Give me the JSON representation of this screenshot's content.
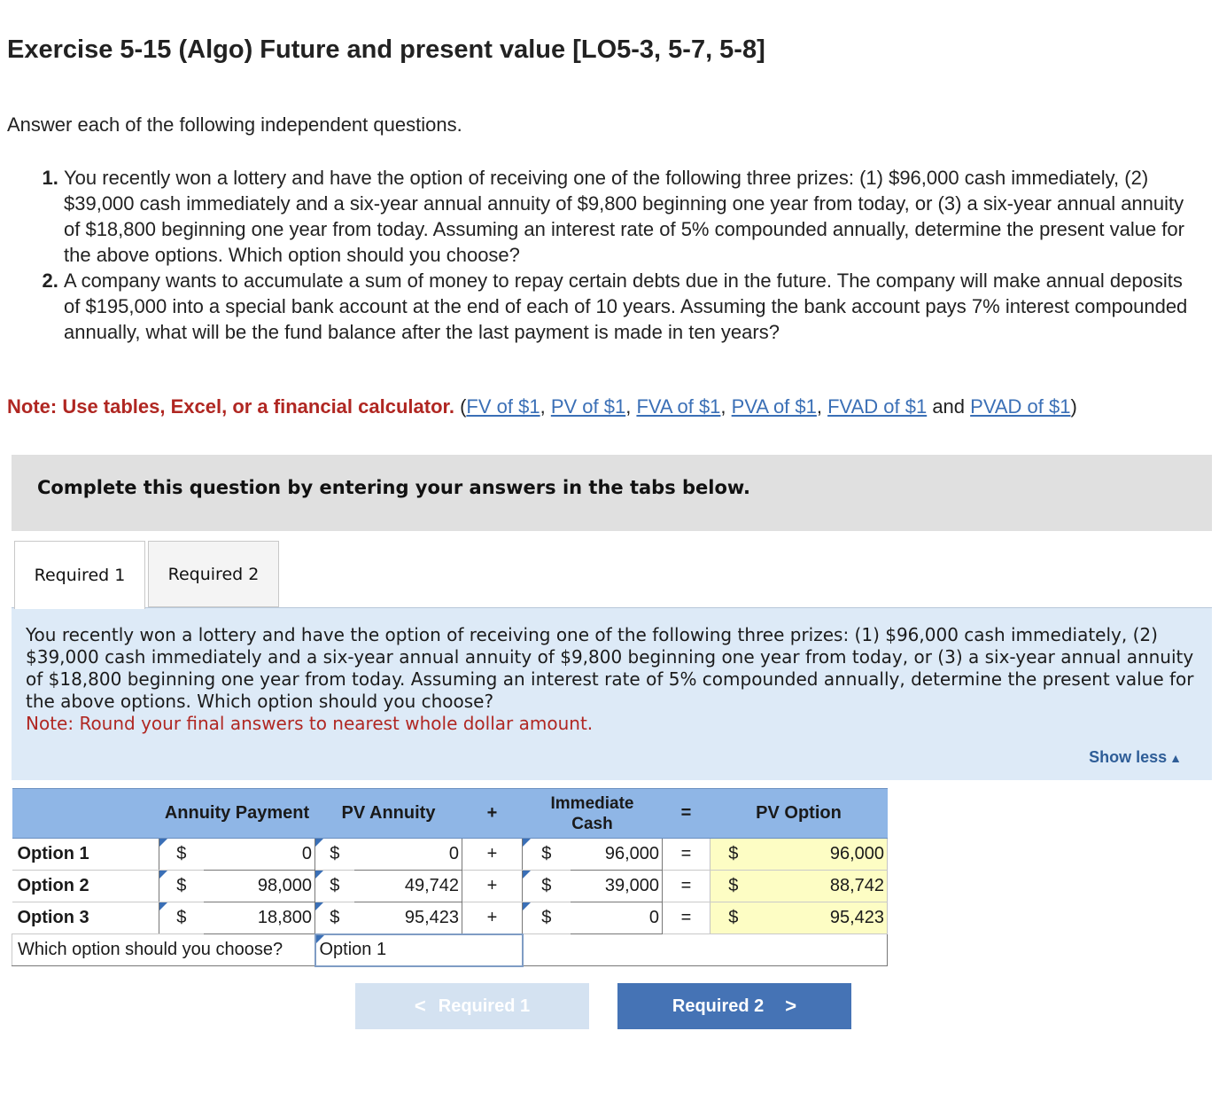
{
  "title": "Exercise 5-15 (Algo) Future and present value [LO5-3, 5-7, 5-8]",
  "intro": "Answer each of the following independent questions.",
  "questions": [
    "You recently won a lottery and have the option of receiving one of the following three prizes: (1) $96,000 cash immediately, (2) $39,000 cash immediately and a six-year annual annuity of $9,800 beginning one year from today, or (3) a six-year annual annuity of $18,800 beginning one year from today. Assuming an interest rate of 5% compounded annually, determine the present value for the above options. Which option should you choose?",
    "A company wants to accumulate a sum of money to repay certain debts due in the future. The company will make annual deposits of $195,000 into a special bank account at the end of each of 10 years. Assuming the bank account pays 7% interest compounded annually, what will be the fund balance after the last payment is made in ten years?"
  ],
  "note": {
    "label": "Note: Use tables, Excel, or a financial calculator.",
    "open": " (",
    "links": [
      "FV of $1",
      "PV of $1",
      "FVA of $1",
      "PVA of $1",
      "FVAD of $1",
      "PVAD of $1"
    ],
    "sep": ", ",
    "and": " and ",
    "close": ")"
  },
  "banner": "Complete this question by entering your answers in the tabs below.",
  "tabs": [
    "Required 1",
    "Required 2"
  ],
  "panel": {
    "text": "You recently won a lottery and have the option of receiving one of the following three prizes: (1) $96,000 cash immediately, (2) $39,000 cash immediately and a six-year annual annuity of $9,800 beginning one year from today, or (3) a six-year annual annuity of $18,800 beginning one year from today. Assuming an interest rate of 5% compounded annually, determine the present value for the above options. Which option should you choose?",
    "note": "Note: Round your final answers to nearest whole dollar amount.",
    "show_less": "Show less"
  },
  "table": {
    "headers": {
      "annuity_payment": "Annuity Payment",
      "pv_annuity": "PV Annuity",
      "plus": "+",
      "immediate_line1": "Immediate",
      "immediate_line2": "Cash",
      "equals": "=",
      "pv_option": "PV Option"
    },
    "currency": "$",
    "plus": "+",
    "equals": "=",
    "rows": [
      {
        "label": "Option 1",
        "annuity_payment": "0",
        "pv_annuity": "0",
        "immediate_cash": "96,000",
        "pv_option": "96,000"
      },
      {
        "label": "Option 2",
        "annuity_payment": "98,000",
        "pv_annuity": "49,742",
        "immediate_cash": "39,000",
        "pv_option": "88,742"
      },
      {
        "label": "Option 3",
        "annuity_payment": "18,800",
        "pv_annuity": "95,423",
        "immediate_cash": "0",
        "pv_option": "95,423"
      }
    ],
    "choice_question": "Which option should you choose?",
    "choice_answer": "Option 1"
  },
  "nav": {
    "prev_label": "Required 1",
    "next_label": "Required 2",
    "prev_icon": "chevron-left-icon",
    "next_icon": "chevron-right-icon"
  },
  "colors": {
    "header_blue": "#8fb6e6",
    "panel_blue": "#ddeaf7",
    "note_red": "#b02722",
    "link_blue": "#3a6fb6",
    "button_blue": "#4573b5",
    "button_disabled": "#d4e2f1",
    "result_yellow": "#fdfdc4"
  }
}
